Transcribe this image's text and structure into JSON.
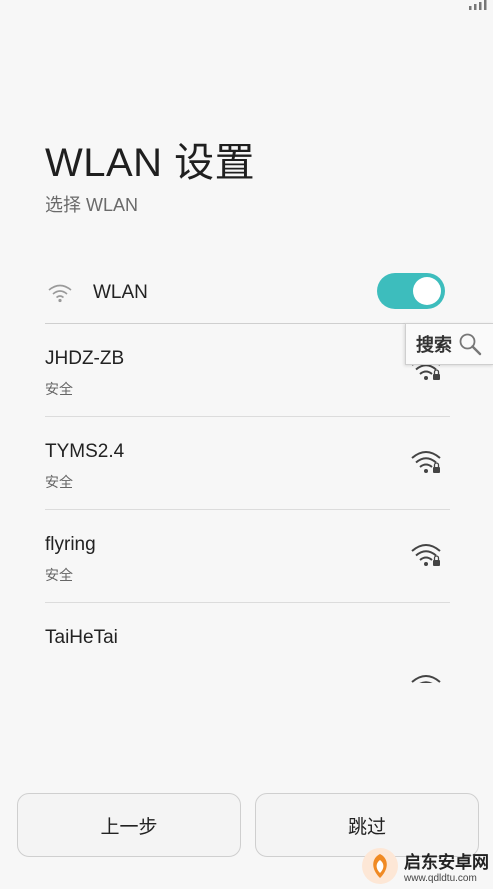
{
  "header": {
    "title": "WLAN 设置",
    "subtitle": "选择 WLAN"
  },
  "wlan_toggle": {
    "label": "WLAN",
    "enabled": true,
    "accent_color": "#3dbdbd"
  },
  "networks": [
    {
      "ssid": "JHDZ-ZB",
      "security": "安全",
      "icon": "wifi-lock-icon"
    },
    {
      "ssid": "TYMS2.4",
      "security": "安全",
      "icon": "wifi-lock-icon"
    },
    {
      "ssid": "flyring",
      "security": "安全",
      "icon": "wifi-lock-icon"
    },
    {
      "ssid": "TaiHeTai",
      "security": "",
      "icon": "wifi-lock-icon"
    }
  ],
  "search": {
    "label": "搜索",
    "icon": "magnifier-icon"
  },
  "footer": {
    "prev_label": "上一步",
    "skip_label": "跳过"
  },
  "watermark": {
    "title": "启东安卓网",
    "url": "www.qdldtu.com",
    "icon": "watermark-logo-icon"
  }
}
